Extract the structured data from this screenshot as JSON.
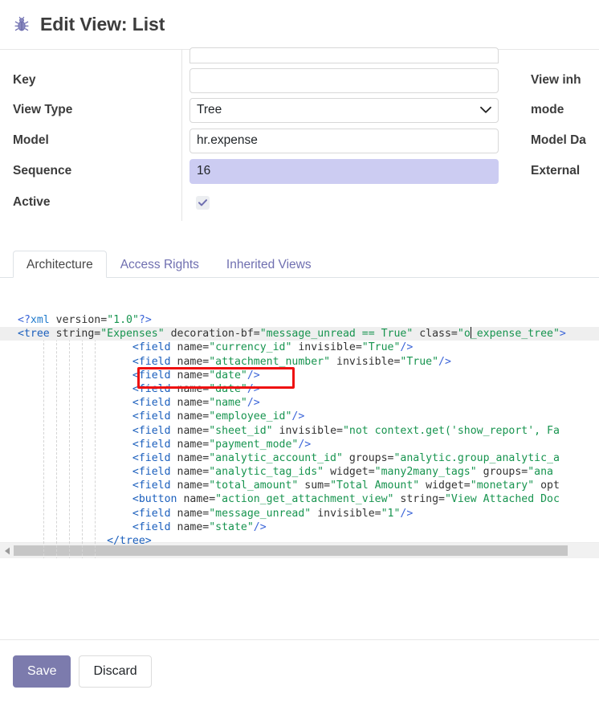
{
  "header": {
    "icon": "bug-icon",
    "title": "Edit View: List"
  },
  "form": {
    "fields": [
      {
        "label": "Key",
        "value": "",
        "type": "text"
      },
      {
        "label": "View Type",
        "value": "Tree",
        "type": "select"
      },
      {
        "label": "Model",
        "value": "hr.expense",
        "type": "text"
      },
      {
        "label": "Sequence",
        "value": "16",
        "type": "text",
        "selected": true
      },
      {
        "label": "Active",
        "value": "",
        "type": "checkbox",
        "checked": true
      }
    ],
    "right_labels": [
      "View inh",
      "mode",
      "Model Da",
      "External"
    ]
  },
  "notebook": {
    "tabs": [
      {
        "label": "Architecture",
        "active": true
      },
      {
        "label": "Access Rights",
        "active": false
      },
      {
        "label": "Inherited Views",
        "active": false
      }
    ]
  },
  "editor": {
    "active_line_index": 1,
    "cursor_line_index": 1,
    "annotation": {
      "target_line_index": 4,
      "color": "#ee1111"
    },
    "lines": [
      [
        {
          "t": "&lt;?",
          "c": "t-punc"
        },
        {
          "t": "xml",
          "c": "t-decl"
        },
        {
          "t": " version=",
          "c": "t-attr"
        },
        {
          "t": "\"1.0\"",
          "c": "t-str"
        },
        {
          "t": "?&gt;",
          "c": "t-punc"
        }
      ],
      [
        {
          "t": "&lt;tree",
          "c": "t-tag"
        },
        {
          "t": " string=",
          "c": "t-attr"
        },
        {
          "t": "\"Expenses\"",
          "c": "t-str"
        },
        {
          "t": " decoration-bf=",
          "c": "t-attr"
        },
        {
          "t": "\"message_unread == True\"",
          "c": "t-str"
        },
        {
          "t": " class=",
          "c": "t-attr"
        },
        {
          "t": "\"o",
          "c": "t-str"
        },
        {
          "t": "|CURSOR|",
          "c": "cursor"
        },
        {
          "t": "_expense_tree\"",
          "c": "t-str"
        },
        {
          "t": "&gt;",
          "c": "t-punc"
        }
      ],
      [
        {
          "t": "                  ",
          "c": "t-attr"
        },
        {
          "t": "&lt;field",
          "c": "t-tag"
        },
        {
          "t": " name=",
          "c": "t-attr"
        },
        {
          "t": "\"currency_id\"",
          "c": "t-str"
        },
        {
          "t": " invisible=",
          "c": "t-attr"
        },
        {
          "t": "\"True\"",
          "c": "t-str"
        },
        {
          "t": "/&gt;",
          "c": "t-punc"
        }
      ],
      [
        {
          "t": "                  ",
          "c": "t-attr"
        },
        {
          "t": "&lt;field",
          "c": "t-tag"
        },
        {
          "t": " name=",
          "c": "t-attr"
        },
        {
          "t": "\"attachment_number\"",
          "c": "t-str"
        },
        {
          "t": " invisible=",
          "c": "t-attr"
        },
        {
          "t": "\"True\"",
          "c": "t-str"
        },
        {
          "t": "/&gt;",
          "c": "t-punc"
        }
      ],
      [
        {
          "t": "                  ",
          "c": "t-attr"
        },
        {
          "t": "&lt;field",
          "c": "t-tag"
        },
        {
          "t": " name=",
          "c": "t-attr"
        },
        {
          "t": "\"date\"",
          "c": "t-str"
        },
        {
          "t": "/&gt;",
          "c": "t-punc"
        }
      ],
      [
        {
          "t": "                  ",
          "c": "t-attr"
        },
        {
          "t": "&lt;field",
          "c": "t-tag"
        },
        {
          "t": " name=",
          "c": "t-attr"
        },
        {
          "t": "\"date\"",
          "c": "t-str"
        },
        {
          "t": "/&gt;",
          "c": "t-punc"
        }
      ],
      [
        {
          "t": "                  ",
          "c": "t-attr"
        },
        {
          "t": "&lt;field",
          "c": "t-tag"
        },
        {
          "t": " name=",
          "c": "t-attr"
        },
        {
          "t": "\"name\"",
          "c": "t-str"
        },
        {
          "t": "/&gt;",
          "c": "t-punc"
        }
      ],
      [
        {
          "t": "                  ",
          "c": "t-attr"
        },
        {
          "t": "&lt;field",
          "c": "t-tag"
        },
        {
          "t": " name=",
          "c": "t-attr"
        },
        {
          "t": "\"employee_id\"",
          "c": "t-str"
        },
        {
          "t": "/&gt;",
          "c": "t-punc"
        }
      ],
      [
        {
          "t": "                  ",
          "c": "t-attr"
        },
        {
          "t": "&lt;field",
          "c": "t-tag"
        },
        {
          "t": " name=",
          "c": "t-attr"
        },
        {
          "t": "\"sheet_id\"",
          "c": "t-str"
        },
        {
          "t": " invisible=",
          "c": "t-attr"
        },
        {
          "t": "\"not context.get('show_report', Fa",
          "c": "t-str"
        }
      ],
      [
        {
          "t": "                  ",
          "c": "t-attr"
        },
        {
          "t": "&lt;field",
          "c": "t-tag"
        },
        {
          "t": " name=",
          "c": "t-attr"
        },
        {
          "t": "\"payment_mode\"",
          "c": "t-str"
        },
        {
          "t": "/&gt;",
          "c": "t-punc"
        }
      ],
      [
        {
          "t": "                  ",
          "c": "t-attr"
        },
        {
          "t": "&lt;field",
          "c": "t-tag"
        },
        {
          "t": " name=",
          "c": "t-attr"
        },
        {
          "t": "\"analytic_account_id\"",
          "c": "t-str"
        },
        {
          "t": " groups=",
          "c": "t-attr"
        },
        {
          "t": "\"analytic.group_analytic_a",
          "c": "t-str"
        }
      ],
      [
        {
          "t": "                  ",
          "c": "t-attr"
        },
        {
          "t": "&lt;field",
          "c": "t-tag"
        },
        {
          "t": " name=",
          "c": "t-attr"
        },
        {
          "t": "\"analytic_tag_ids\"",
          "c": "t-str"
        },
        {
          "t": " widget=",
          "c": "t-attr"
        },
        {
          "t": "\"many2many_tags\"",
          "c": "t-str"
        },
        {
          "t": " groups=",
          "c": "t-attr"
        },
        {
          "t": "\"ana",
          "c": "t-str"
        }
      ],
      [
        {
          "t": "                  ",
          "c": "t-attr"
        },
        {
          "t": "&lt;field",
          "c": "t-tag"
        },
        {
          "t": " name=",
          "c": "t-attr"
        },
        {
          "t": "\"total_amount\"",
          "c": "t-str"
        },
        {
          "t": " sum=",
          "c": "t-attr"
        },
        {
          "t": "\"Total Amount\"",
          "c": "t-str"
        },
        {
          "t": " widget=",
          "c": "t-attr"
        },
        {
          "t": "\"monetary\"",
          "c": "t-str"
        },
        {
          "t": " opt",
          "c": "t-attr"
        }
      ],
      [
        {
          "t": "                  ",
          "c": "t-attr"
        },
        {
          "t": "&lt;button",
          "c": "t-tag"
        },
        {
          "t": " name=",
          "c": "t-attr"
        },
        {
          "t": "\"action_get_attachment_view\"",
          "c": "t-str"
        },
        {
          "t": " string=",
          "c": "t-attr"
        },
        {
          "t": "\"View Attached Doc",
          "c": "t-str"
        }
      ],
      [
        {
          "t": "                  ",
          "c": "t-attr"
        },
        {
          "t": "&lt;field",
          "c": "t-tag"
        },
        {
          "t": " name=",
          "c": "t-attr"
        },
        {
          "t": "\"message_unread\"",
          "c": "t-str"
        },
        {
          "t": " invisible=",
          "c": "t-attr"
        },
        {
          "t": "\"1\"",
          "c": "t-str"
        },
        {
          "t": "/&gt;",
          "c": "t-punc"
        }
      ],
      [
        {
          "t": "                  ",
          "c": "t-attr"
        },
        {
          "t": "&lt;field",
          "c": "t-tag"
        },
        {
          "t": " name=",
          "c": "t-attr"
        },
        {
          "t": "\"state\"",
          "c": "t-str"
        },
        {
          "t": "/&gt;",
          "c": "t-punc"
        }
      ],
      [
        {
          "t": "              ",
          "c": "t-attr"
        },
        {
          "t": "&lt;/tree&gt;",
          "c": "t-tag"
        }
      ]
    ],
    "scrollbar": {
      "orientation": "horizontal",
      "thumb_ratio": 0.95
    }
  },
  "footer": {
    "save_label": "Save",
    "discard_label": "Discard"
  },
  "colors": {
    "primary": "#7c7bad",
    "selection": "#ccccf2",
    "annotation": "#ee1111",
    "tab_inactive": "#6f6fb0",
    "string": "#17944f",
    "tag": "#1b5fbd"
  }
}
